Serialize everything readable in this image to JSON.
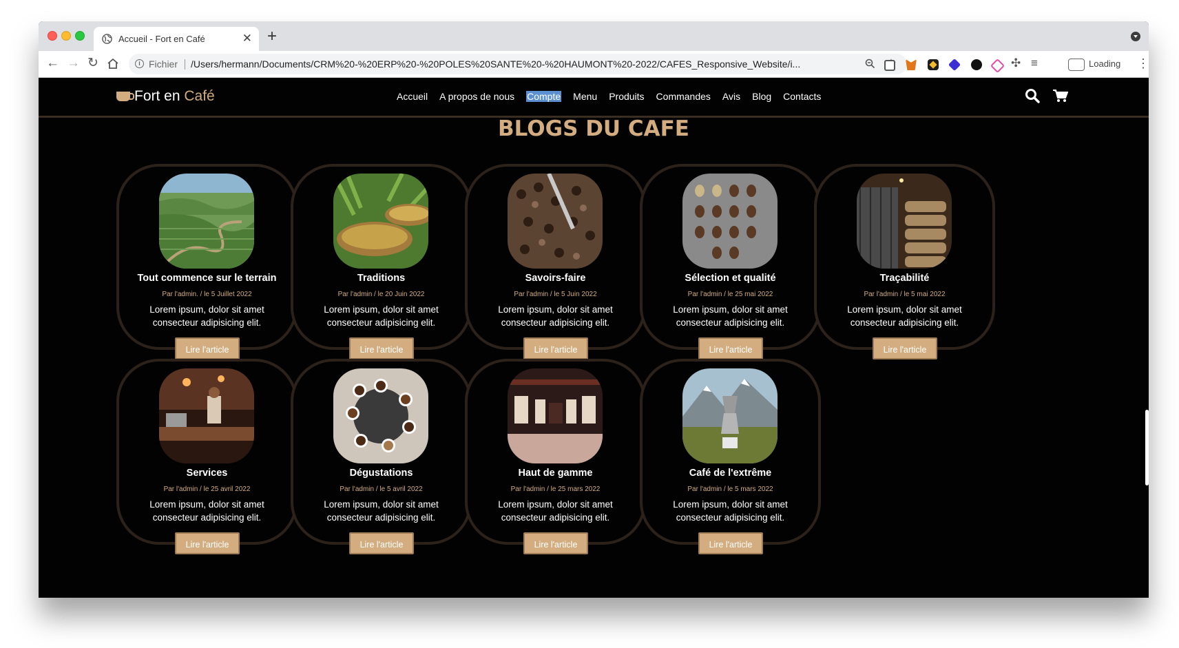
{
  "browser": {
    "tab_title": "Accueil - Fort en Café",
    "tab_close": "✕",
    "new_tab": "+",
    "protocol_label": "Fichier",
    "url": "/Users/hermann/Documents/CRM%20-%20ERP%20-%20POLES%20SANTE%20-%20HAUMONT%20-2022/CAFES_Responsive_Website/i...",
    "status_text": "Loading",
    "icons": [
      "back-icon",
      "forward-icon",
      "reload-icon",
      "home-icon",
      "info-icon",
      "zoom-icon",
      "star-icon",
      "extensions-icon",
      "reading-list-icon",
      "profile-icon",
      "kebab-menu-icon"
    ]
  },
  "site": {
    "logo_brand": "Fort en ",
    "logo_accent": "Café",
    "nav": [
      "Accueil",
      "A propos de nous",
      "Compte",
      "Menu",
      "Produits",
      "Commandes",
      "Avis",
      "Blog",
      "Contacts"
    ],
    "active_nav": "Compte",
    "heading": "BLOGS DU CAFE",
    "accent_color": "#d3ad7f",
    "background_color": "#020203"
  },
  "cards": [
    {
      "title": "Tout commence sur le terrain",
      "meta": "Par l'admin. / le 5 Juillet 2022",
      "text": "Lorem ipsum, dolor sit amet consecteur adipisicing elit.",
      "button": "Lire l'article",
      "image": "terraced-hills"
    },
    {
      "title": "Traditions",
      "meta": "Par l'admin / le 20 Juin 2022",
      "text": "Lorem ipsum, dolor sit amet consecteur adipisicing elit.",
      "button": "Lire l'article",
      "image": "drying-baskets"
    },
    {
      "title": "Savoirs-faire",
      "meta": "Par l'admin / le 5 Juin 2022",
      "text": "Lorem ipsum, dolor sit amet consecteur adipisicing elit.",
      "button": "Lire l'article",
      "image": "roasting-beans"
    },
    {
      "title": "Sélection et qualité",
      "meta": "Par l'admin / le 25 mai 2022",
      "text": "Lorem ipsum, dolor sit amet consecteur adipisicing elit.",
      "button": "Lire l'article",
      "image": "bean-grid"
    },
    {
      "title": "Traçabilité",
      "meta": "Par l'admin / le 5 mai 2022",
      "text": "Lorem ipsum, dolor sit amet consecteur adipisicing elit.",
      "button": "Lire l'article",
      "image": "warehouse-sacks"
    },
    {
      "title": "Services",
      "meta": "Par l'admin / le 25 avril 2022",
      "text": "Lorem ipsum, dolor sit amet consecteur adipisicing elit.",
      "button": "Lire l'article",
      "image": "barista-bar"
    },
    {
      "title": "Dégustations",
      "meta": "Par l'admin / le 5 avril 2022",
      "text": "Lorem ipsum, dolor sit amet consecteur adipisicing elit.",
      "button": "Lire l'article",
      "image": "tasting-cups"
    },
    {
      "title": "Haut de gamme",
      "meta": "Par l'admin / le 25 mars 2022",
      "text": "Lorem ipsum, dolor sit amet consecteur adipisicing elit.",
      "button": "Lire l'article",
      "image": "luxury-store"
    },
    {
      "title": "Café de l'extrême",
      "meta": "Par l'admin / le 5 mars 2022",
      "text": "Lorem ipsum, dolor sit amet consecteur adipisicing elit.",
      "button": "Lire l'article",
      "image": "mountain-moka"
    }
  ]
}
